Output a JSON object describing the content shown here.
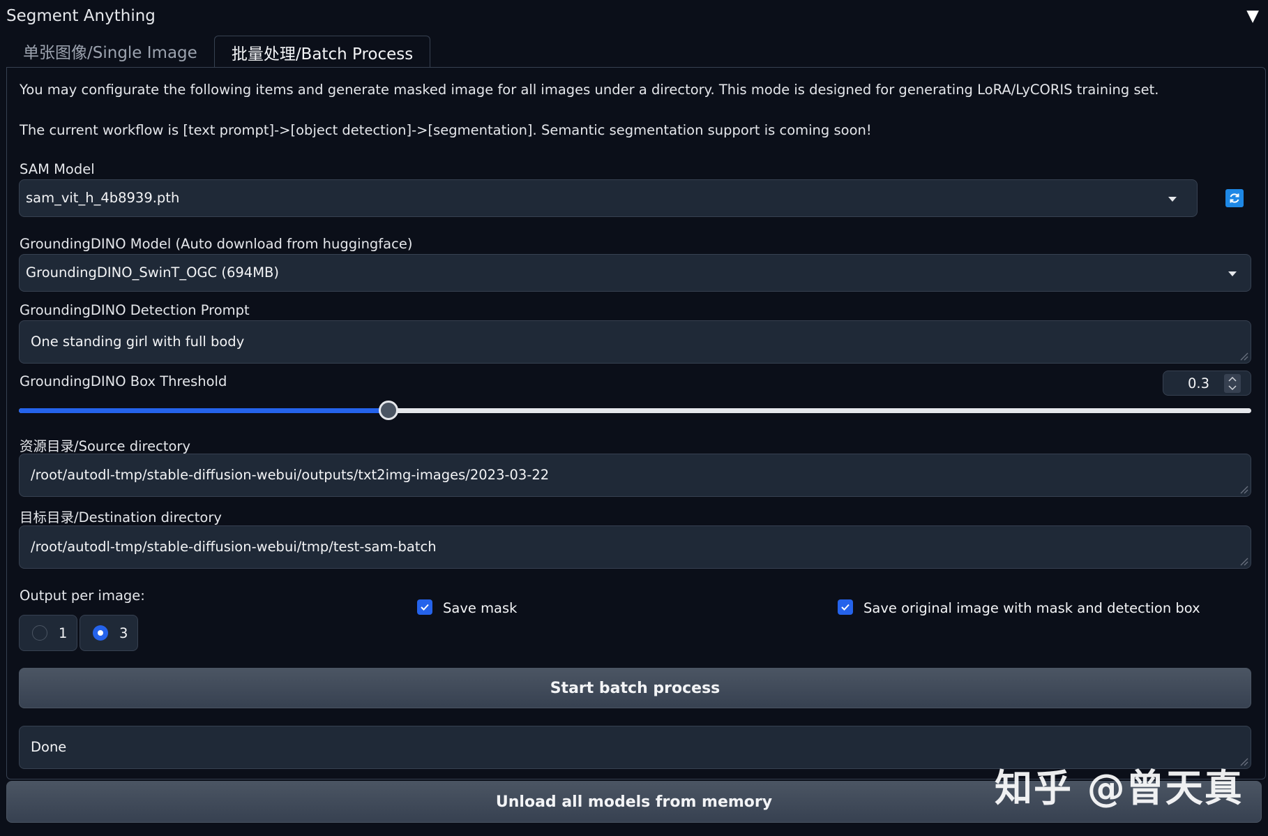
{
  "accordion": {
    "title": "Segment Anything",
    "toggle_glyph": "▼"
  },
  "tabs": [
    {
      "label": "单张图像/Single Image",
      "active": false
    },
    {
      "label": "批量处理/Batch Process",
      "active": true
    }
  ],
  "description": {
    "line1": "You may configurate the following items and generate masked image for all images under a directory. This mode is designed for generating LoRA/LyCORIS training set.",
    "line2": "The current workflow is [text prompt]->[object detection]->[segmentation]. Semantic segmentation support is coming soon!"
  },
  "sam_model": {
    "label": "SAM Model",
    "value": "sam_vit_h_4b8939.pth",
    "refresh_icon": "refresh-icon"
  },
  "dino_model": {
    "label": "GroundingDINO Model (Auto download from huggingface)",
    "value": "GroundingDINO_SwinT_OGC (694MB)"
  },
  "dino_prompt": {
    "label": "GroundingDINO Detection Prompt",
    "value": "One standing girl with full body"
  },
  "box_threshold": {
    "label": "GroundingDINO Box Threshold",
    "value": "0.3",
    "fraction": 0.3
  },
  "source_dir": {
    "label": "资源目录/Source directory",
    "value": "/root/autodl-tmp/stable-diffusion-webui/outputs/txt2img-images/2023-03-22"
  },
  "dest_dir": {
    "label": "目标目录/Destination directory",
    "value": "/root/autodl-tmp/stable-diffusion-webui/tmp/test-sam-batch"
  },
  "output_per_image": {
    "label": "Output per image:",
    "options": [
      {
        "label": "1",
        "checked": false
      },
      {
        "label": "3",
        "checked": true
      }
    ]
  },
  "save_mask": {
    "label": "Save mask",
    "checked": true
  },
  "save_original": {
    "label": "Save original image with mask and detection box",
    "checked": true
  },
  "start_button": "Start batch process",
  "status": "Done",
  "unload_button": "Unload all models from memory",
  "watermark": "知乎 @曾天真",
  "colors": {
    "accent": "#2563eb",
    "background": "#0b0f19",
    "field": "#1f2937",
    "refresh": "#1e88e5"
  }
}
